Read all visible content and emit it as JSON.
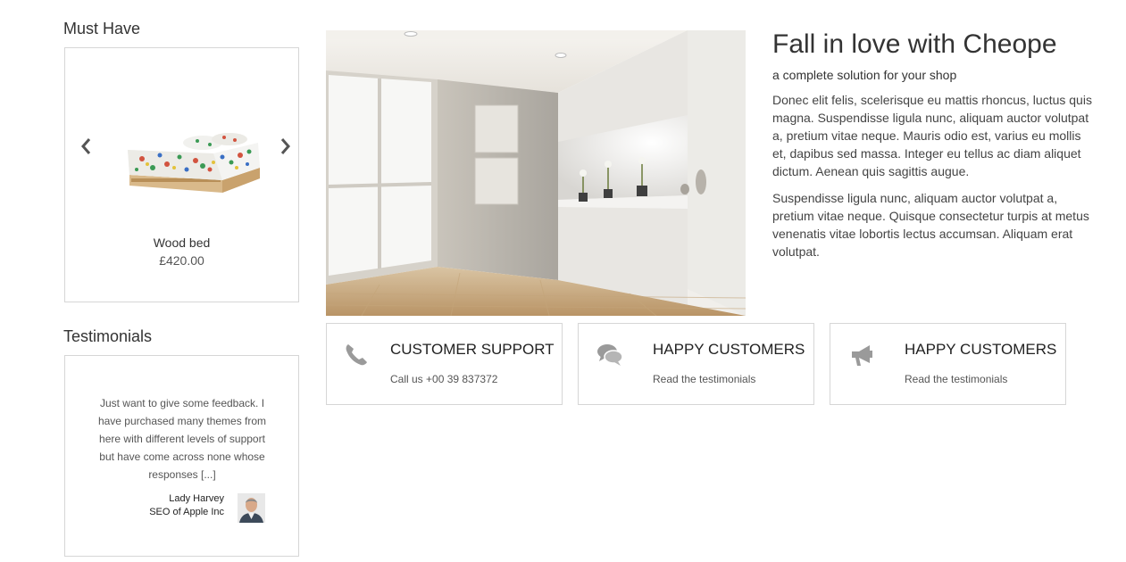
{
  "must_have": {
    "title": "Must Have",
    "product": {
      "name": "Wood bed",
      "price": "£420.00"
    }
  },
  "testimonials": {
    "title": "Testimonials",
    "quote": "Just want to give some feedback. I have purchased many themes from here with different levels of support but have come across none whose responses [...]",
    "author": "Lady Harvey",
    "role": "SEO of Apple Inc"
  },
  "hero": {
    "title": "Fall in love with Cheope",
    "subtitle": "a complete solution for your shop",
    "paragraph_1": "Donec elit felis, scelerisque eu mattis rhoncus, luctus quis magna. Suspendisse ligula nunc, aliquam auctor volutpat a, pretium vitae neque. Mauris odio est, varius eu mollis et, dapibus sed massa. Integer eu tellus ac diam aliquet dictum. Aenean quis sagittis augue.",
    "paragraph_2": "Suspendisse ligula nunc, aliquam auctor volutpat a, pretium vitae neque. Quisque consectetur turpis at metus venenatis vitae lobortis lectus accumsan. Aliquam erat volutpat."
  },
  "features": [
    {
      "icon": "phone-icon",
      "title": "CUSTOMER SUPPORT",
      "subtitle": "Call us +00 39 837372"
    },
    {
      "icon": "chat-bubbles-icon",
      "title": "HAPPY CUSTOMERS",
      "subtitle": "Read the testimonials"
    },
    {
      "icon": "megaphone-icon",
      "title": "HAPPY CUSTOMERS",
      "subtitle": "Read the testimonials"
    }
  ],
  "colors": {
    "border": "#d6d6d6",
    "icon": "#9a9a9a",
    "text": "#333333"
  }
}
